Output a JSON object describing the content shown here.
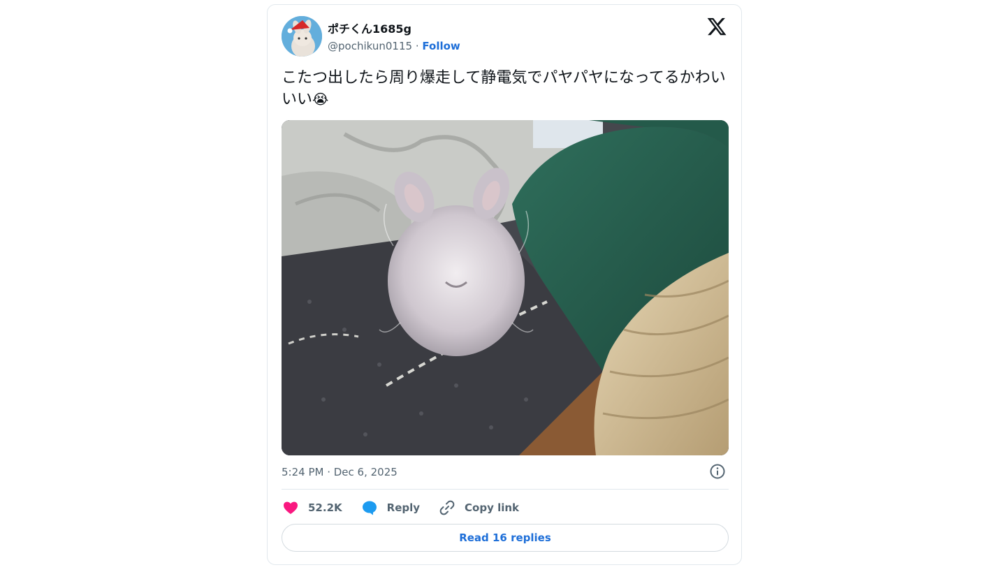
{
  "author": {
    "display_name": "ポチくん1685g",
    "handle": "@pochikun0115",
    "separator": "·",
    "follow_label": "Follow"
  },
  "brand": {
    "logo_icon": "x-logo-icon"
  },
  "tweet": {
    "text": "こたつ出したら周り爆走して静電気でパヤパヤになってるかわいいい",
    "emoji": "😭",
    "timestamp": "5:24 PM · Dec 6, 2025"
  },
  "actions": {
    "likes_count": "52.2K",
    "reply_label": "Reply",
    "copy_link_label": "Copy link",
    "read_replies_label": "Read 16 replies"
  },
  "colors": {
    "link_blue": "#1d6ed8",
    "heart_pink": "#f91880",
    "reply_blue": "#1d9bf0",
    "muted_gray": "#536471"
  },
  "icons": [
    "x-logo-icon",
    "info-icon",
    "heart-icon",
    "reply-bubble-icon",
    "link-icon"
  ]
}
